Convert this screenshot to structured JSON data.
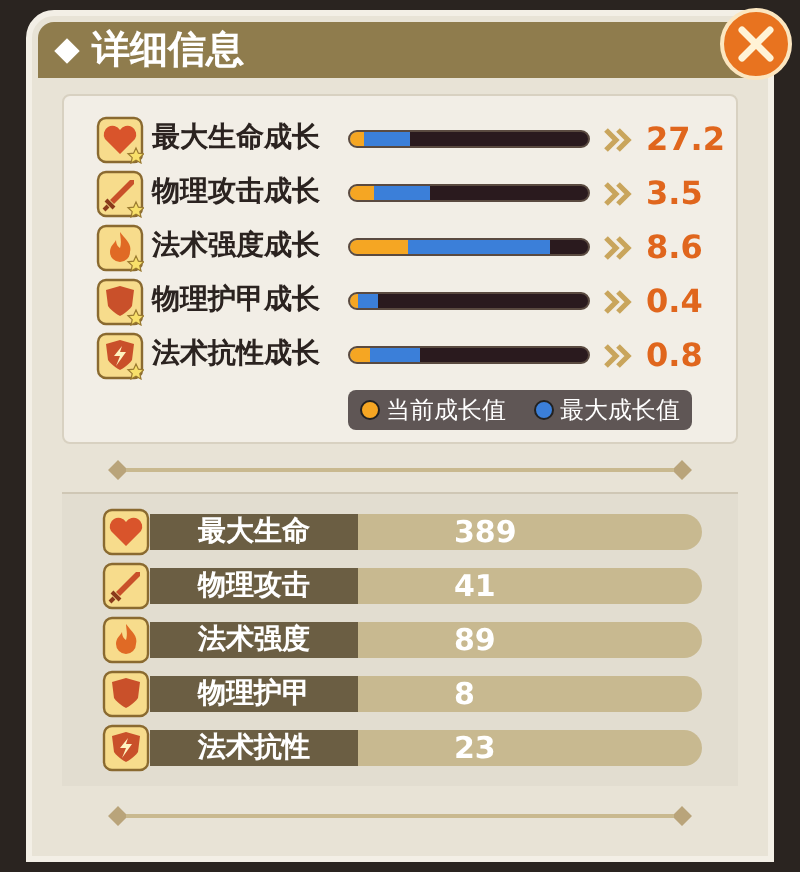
{
  "window": {
    "title": "详细信息"
  },
  "growth": [
    {
      "label": "最大生命成长",
      "bar_current": {
        "level": 0.06
      },
      "bar_max": {
        "level": 0.25
      },
      "value": "27.2"
    },
    {
      "label": "物理攻击成长",
      "bar_current": {
        "level": 0.1
      },
      "bar_max": {
        "level": 0.34
      },
      "value": "3.5"
    },
    {
      "label": "法术强度成长",
      "bar_current": {
        "level": 0.24
      },
      "bar_max": {
        "level": 0.84
      },
      "value": "8.6"
    },
    {
      "label": "物理护甲成长",
      "bar_current": {
        "level": 0.03
      },
      "bar_max": {
        "level": 0.12
      },
      "value": "0.4"
    },
    {
      "label": "法术抗性成长",
      "bar_current": {
        "level": 0.08
      },
      "bar_max": {
        "level": 0.29
      },
      "value": "0.8"
    }
  ],
  "legend": [
    {
      "label": "当前成长值",
      "color": "#f5a623"
    },
    {
      "label": "最大成长值",
      "color": "#3b7fd9"
    }
  ],
  "stats": [
    {
      "label": "最大生命",
      "value": "389"
    },
    {
      "label": "物理攻击",
      "value": "41"
    },
    {
      "label": "法术强度",
      "value": "89"
    },
    {
      "label": "物理护甲",
      "value": "8"
    },
    {
      "label": "法术抗性",
      "value": "23"
    }
  ]
}
